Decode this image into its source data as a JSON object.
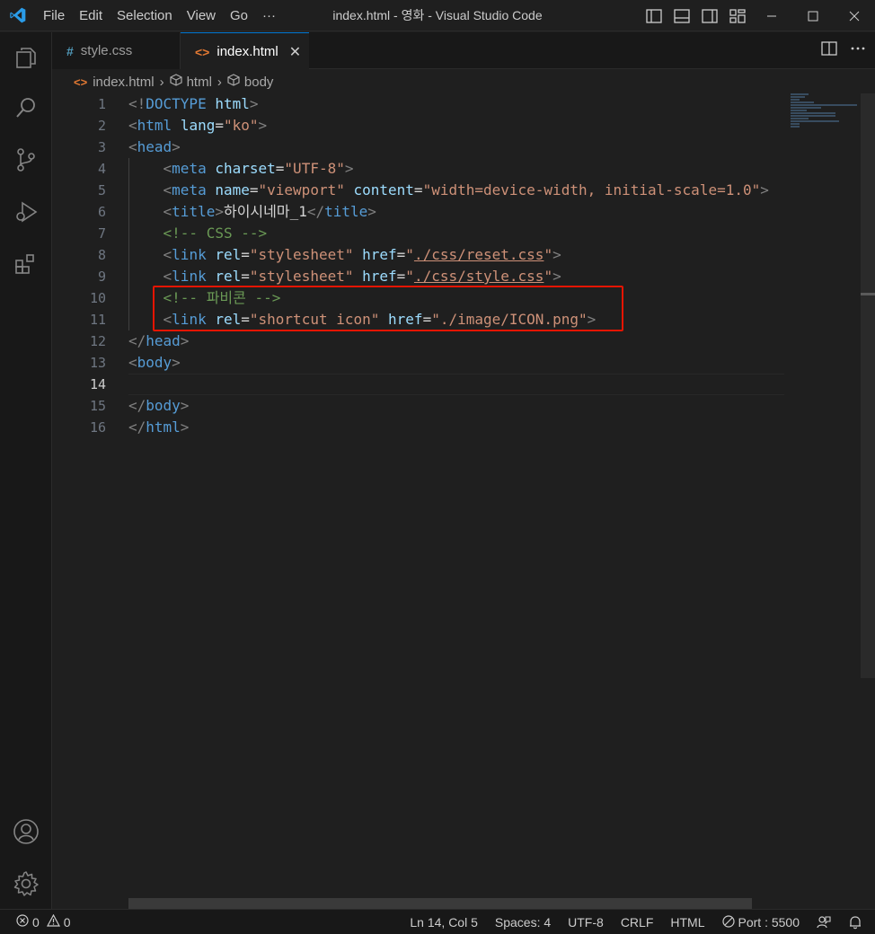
{
  "window": {
    "title": "index.html - 영화 - Visual Studio Code",
    "menu": [
      "File",
      "Edit",
      "Selection",
      "View",
      "Go",
      "···"
    ]
  },
  "activity_bar": {
    "items": [
      "explorer-icon",
      "search-icon",
      "source-control-icon",
      "run-debug-icon",
      "extensions-icon"
    ],
    "bottom": [
      "accounts-icon",
      "manage-gear-icon"
    ]
  },
  "tabs": [
    {
      "icon": "#",
      "label": "style.css",
      "active": false
    },
    {
      "icon": "<>",
      "label": "index.html",
      "active": true,
      "close": "✕"
    }
  ],
  "breadcrumb": {
    "icon": "<>",
    "items": [
      "index.html",
      "html",
      "body"
    ]
  },
  "editor": {
    "line_numbers": [
      "1",
      "2",
      "3",
      "4",
      "5",
      "6",
      "7",
      "8",
      "9",
      "10",
      "11",
      "12",
      "13",
      "14",
      "15",
      "16"
    ],
    "active_line": 14,
    "lines": [
      [
        [
          "tp",
          "<!"
        ],
        [
          "tg",
          "DOCTYPE"
        ],
        [
          "tx",
          " "
        ],
        [
          "at",
          "html"
        ],
        [
          "tp",
          ">"
        ]
      ],
      [
        [
          "tp",
          "<"
        ],
        [
          "tg",
          "html"
        ],
        [
          "tx",
          " "
        ],
        [
          "at",
          "lang"
        ],
        [
          "tx",
          "="
        ],
        [
          "sv",
          "\"ko\""
        ],
        [
          "tp",
          ">"
        ]
      ],
      [
        [
          "tp",
          "<"
        ],
        [
          "tg",
          "head"
        ],
        [
          "tp",
          ">"
        ]
      ],
      [
        [
          "tx",
          "    "
        ],
        [
          "tp",
          "<"
        ],
        [
          "tg",
          "meta"
        ],
        [
          "tx",
          " "
        ],
        [
          "at",
          "charset"
        ],
        [
          "tx",
          "="
        ],
        [
          "sv",
          "\"UTF-8\""
        ],
        [
          "tp",
          ">"
        ]
      ],
      [
        [
          "tx",
          "    "
        ],
        [
          "tp",
          "<"
        ],
        [
          "tg",
          "meta"
        ],
        [
          "tx",
          " "
        ],
        [
          "at",
          "name"
        ],
        [
          "tx",
          "="
        ],
        [
          "sv",
          "\"viewport\""
        ],
        [
          "tx",
          " "
        ],
        [
          "at",
          "content"
        ],
        [
          "tx",
          "="
        ],
        [
          "sv",
          "\"width=device-width, initial-scale=1.0\""
        ],
        [
          "tp",
          ">"
        ]
      ],
      [
        [
          "tx",
          "    "
        ],
        [
          "tp",
          "<"
        ],
        [
          "tg",
          "title"
        ],
        [
          "tp",
          ">"
        ],
        [
          "tx",
          "하이시네마_1"
        ],
        [
          "tp",
          "</"
        ],
        [
          "tg",
          "title"
        ],
        [
          "tp",
          ">"
        ]
      ],
      [
        [
          "tx",
          "    "
        ],
        [
          "cm",
          "<!-- CSS -->"
        ]
      ],
      [
        [
          "tx",
          "    "
        ],
        [
          "tp",
          "<"
        ],
        [
          "tg",
          "link"
        ],
        [
          "tx",
          " "
        ],
        [
          "at",
          "rel"
        ],
        [
          "tx",
          "="
        ],
        [
          "sv",
          "\"stylesheet\""
        ],
        [
          "tx",
          " "
        ],
        [
          "at",
          "href"
        ],
        [
          "tx",
          "="
        ],
        [
          "sv",
          "\""
        ],
        [
          "ul",
          "./css/reset.css"
        ],
        [
          "sv",
          "\""
        ],
        [
          "tp",
          ">"
        ]
      ],
      [
        [
          "tx",
          "    "
        ],
        [
          "tp",
          "<"
        ],
        [
          "tg",
          "link"
        ],
        [
          "tx",
          " "
        ],
        [
          "at",
          "rel"
        ],
        [
          "tx",
          "="
        ],
        [
          "sv",
          "\"stylesheet\""
        ],
        [
          "tx",
          " "
        ],
        [
          "at",
          "href"
        ],
        [
          "tx",
          "="
        ],
        [
          "sv",
          "\""
        ],
        [
          "ul",
          "./css/style.css"
        ],
        [
          "sv",
          "\""
        ],
        [
          "tp",
          ">"
        ]
      ],
      [
        [
          "tx",
          "    "
        ],
        [
          "cm",
          "<!-- 파비콘 -->"
        ]
      ],
      [
        [
          "tx",
          "    "
        ],
        [
          "tp",
          "<"
        ],
        [
          "tg",
          "link"
        ],
        [
          "tx",
          " "
        ],
        [
          "at",
          "rel"
        ],
        [
          "tx",
          "="
        ],
        [
          "sv",
          "\"shortcut icon\""
        ],
        [
          "tx",
          " "
        ],
        [
          "at",
          "href"
        ],
        [
          "tx",
          "="
        ],
        [
          "sv",
          "\"./image/ICON.png\""
        ],
        [
          "tp",
          ">"
        ]
      ],
      [
        [
          "tp",
          "</"
        ],
        [
          "tg",
          "head"
        ],
        [
          "tp",
          ">"
        ]
      ],
      [
        [
          "tp",
          "<"
        ],
        [
          "tg",
          "body"
        ],
        [
          "tp",
          ">"
        ]
      ],
      [],
      [
        [
          "tp",
          "</"
        ],
        [
          "tg",
          "body"
        ],
        [
          "tp",
          ">"
        ]
      ],
      [
        [
          "tp",
          "</"
        ],
        [
          "tg",
          "html"
        ],
        [
          "tp",
          ">"
        ]
      ]
    ]
  },
  "colors": {
    "highlight_box": "#e51400",
    "active_tab_border": "#0078d4",
    "tag": "#569cd6",
    "attribute": "#9cdcfe",
    "string": "#ce9178",
    "comment": "#6a9955"
  },
  "status_bar": {
    "errors": "0",
    "warnings": "0",
    "position": "Ln 14, Col 5",
    "spaces": "Spaces: 4",
    "encoding": "UTF-8",
    "eol": "CRLF",
    "language": "HTML",
    "port": "Port : 5500"
  }
}
